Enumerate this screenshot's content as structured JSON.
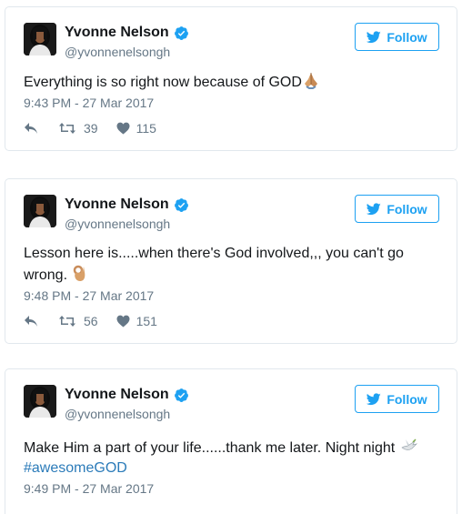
{
  "follow_label": "Follow",
  "accent": "#1da1f2",
  "tweets": [
    {
      "name": "Yvonne Nelson",
      "handle": "@yvonnenelsongh",
      "text": "Everything is so right now because of GOD",
      "emoji": "folded-hands-emoji",
      "time": "9:43 PM - 27 Mar 2017",
      "retweets": "39",
      "likes": "115"
    },
    {
      "name": "Yvonne Nelson",
      "handle": "@yvonnenelsongh",
      "text": "Lesson here is.....when there's God involved,,, you can't go wrong.",
      "emoji": "ok-hand-emoji",
      "time": "9:48 PM - 27 Mar 2017",
      "retweets": "56",
      "likes": "151"
    },
    {
      "name": "Yvonne Nelson",
      "handle": "@yvonnenelsongh",
      "text": "Make Him a part of your life......thank me later. Night night",
      "emoji": "dove-emoji",
      "hashtag": "#awesomeGOD",
      "time": "9:49 PM - 27 Mar 2017"
    }
  ]
}
